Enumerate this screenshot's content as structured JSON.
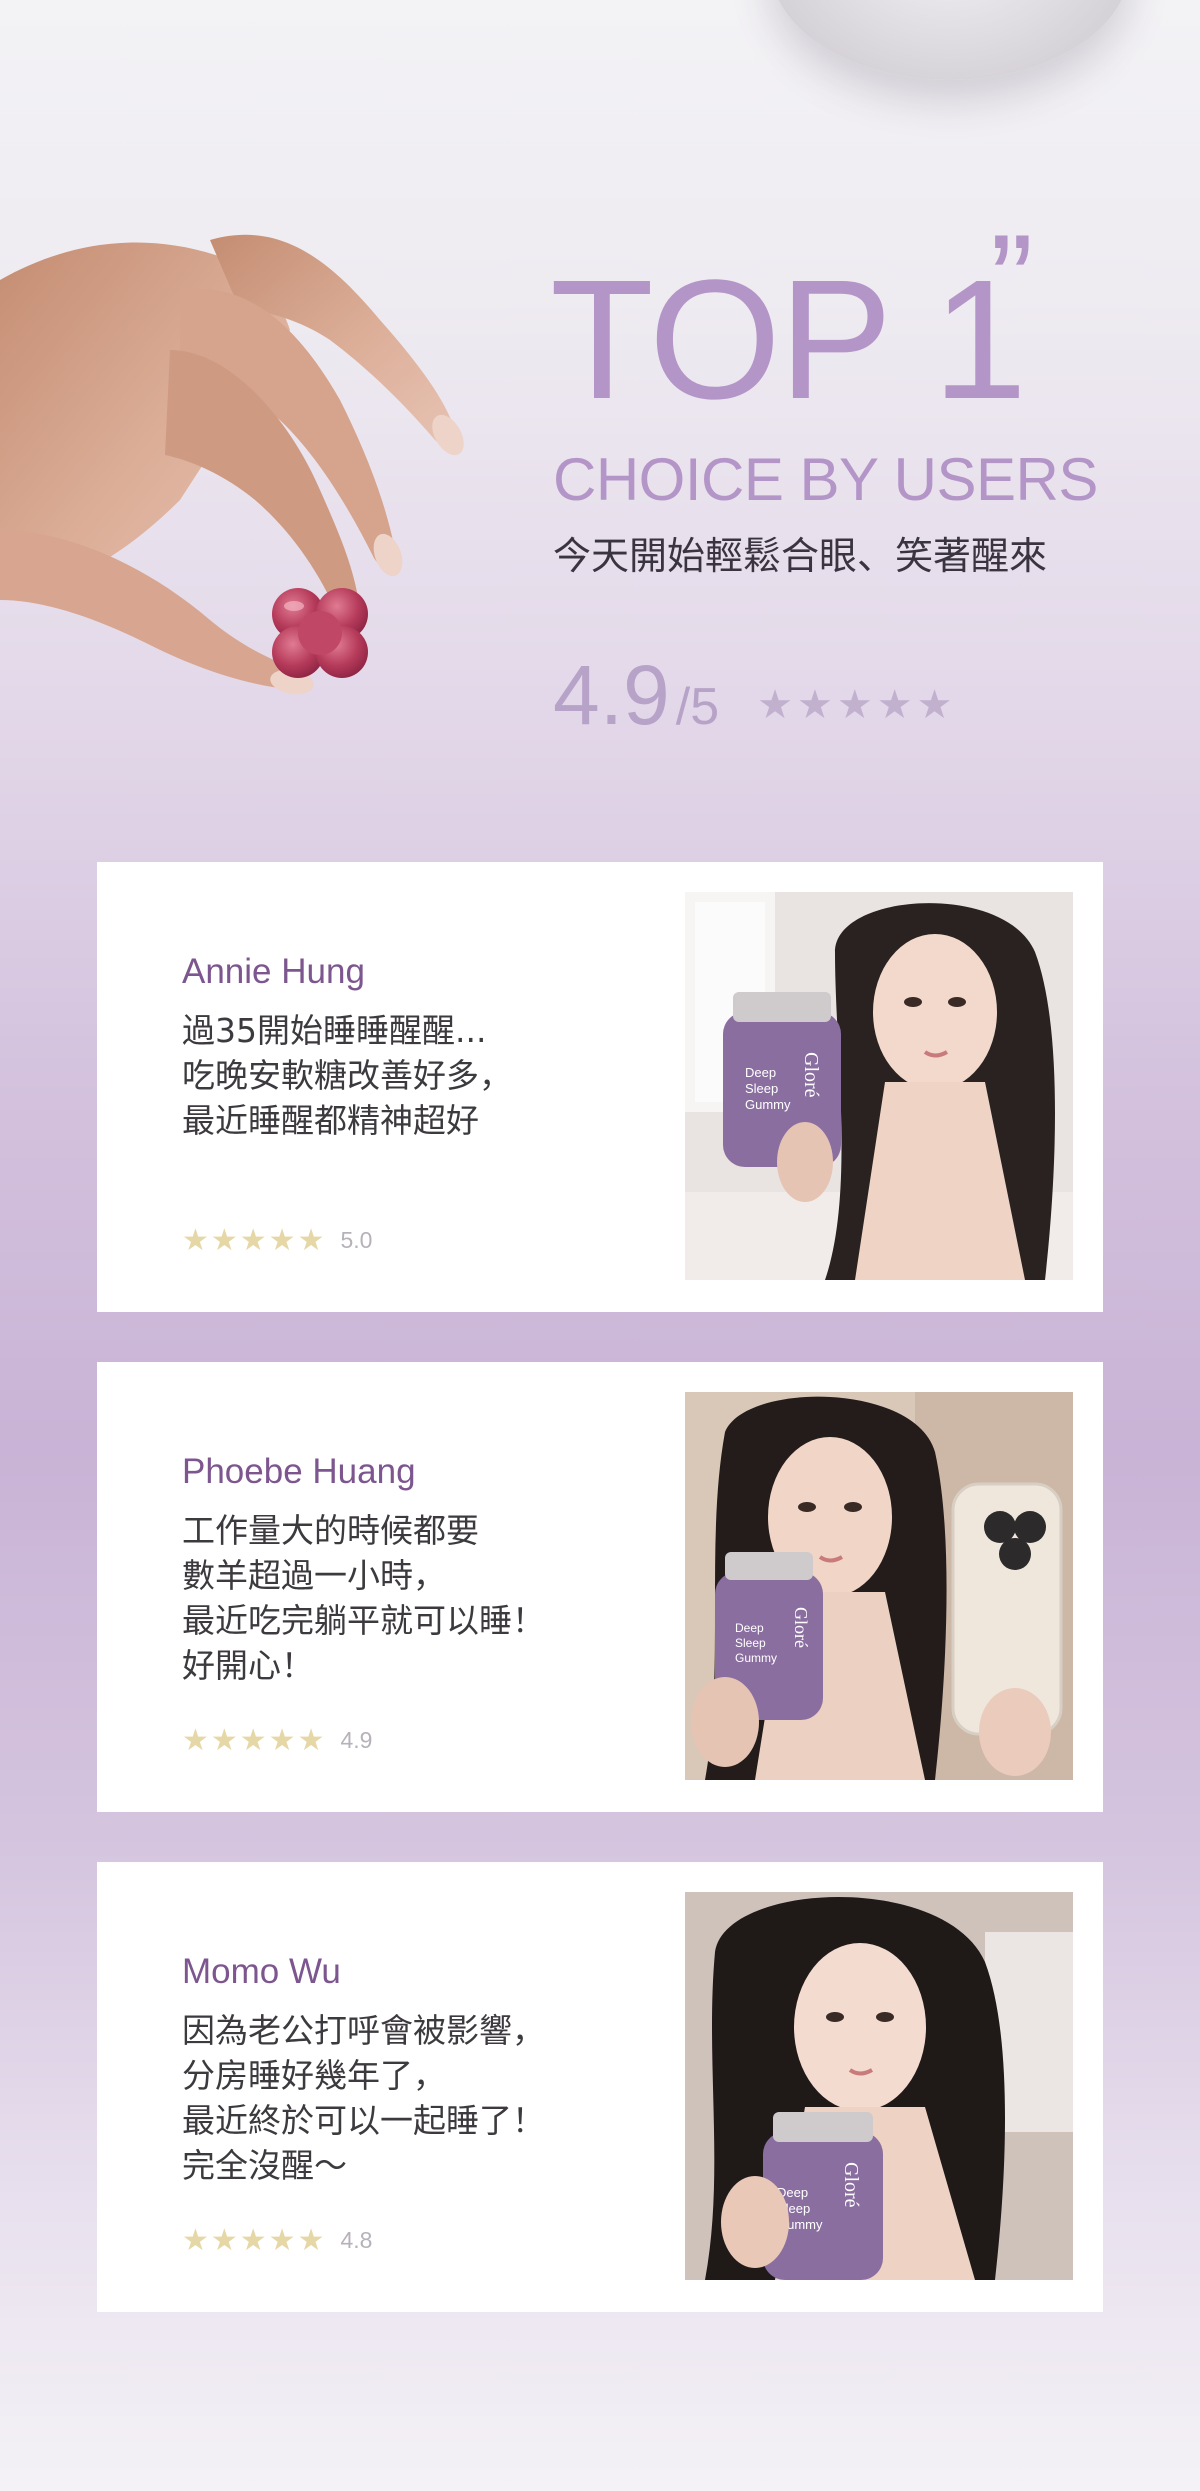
{
  "hero": {
    "top_line": "TOP 1",
    "quote_mark": "”",
    "subtitle": "CHOICE BY USERS",
    "tagline": "今天開始輕鬆合眼、笑著醒來",
    "rating_score": "4.9",
    "rating_out_of": "/5",
    "rating_stars": "★★★★★"
  },
  "colors": {
    "accent": "#b495c8",
    "name": "#7d5690",
    "star_gold": "#e6d7a6",
    "body_text": "#3c3a3e"
  },
  "reviews": [
    {
      "name": "Annie Hung",
      "lines": [
        "過35開始睡睡醒醒...",
        "吃晚安軟糖改善好多，",
        "最近睡醒都精神超好"
      ],
      "stars": "★★★★★",
      "score": "5.0",
      "photo_icon": "portrait-with-supplement-bottle"
    },
    {
      "name": "Phoebe Huang",
      "lines": [
        "工作量大的時候都要",
        "數羊超過一小時，",
        "最近吃完躺平就可以睡！",
        "好開心！"
      ],
      "stars": "★★★★★",
      "score": "4.9",
      "photo_icon": "selfie-with-supplement-bottle"
    },
    {
      "name": "Momo Wu",
      "lines": [
        "因為老公打呼會被影響，",
        "分房睡好幾年了，",
        "最近終於可以一起睡了！",
        "完全沒醒～"
      ],
      "stars": "★★★★★",
      "score": "4.8",
      "photo_icon": "portrait-with-supplement-bottle"
    }
  ],
  "product_label": {
    "brand": "Gloré",
    "name_lines": [
      "Deep",
      "Sleep",
      "Gummy"
    ]
  }
}
